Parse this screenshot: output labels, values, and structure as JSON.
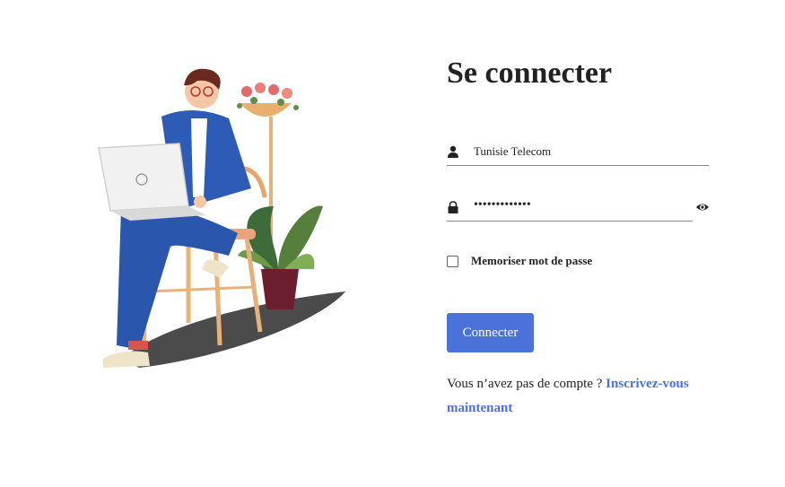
{
  "login": {
    "title": "Se connecter",
    "username_value": "Tunisie Telecom",
    "password_masked": "•••••••••••••",
    "remember_label": "Memoriser mot de passe",
    "remember_checked": false,
    "submit_label": "Connecter",
    "signup_prompt": "Vous n’avez pas de compte ?",
    "signup_link": "Inscrivez-vous maintenant"
  },
  "icons": {
    "username": "user-icon",
    "password": "lock-icon",
    "toggle_password": "eye-icon"
  },
  "colors": {
    "accent": "#4a72d9",
    "text": "#222222",
    "background": "#ffffff"
  }
}
